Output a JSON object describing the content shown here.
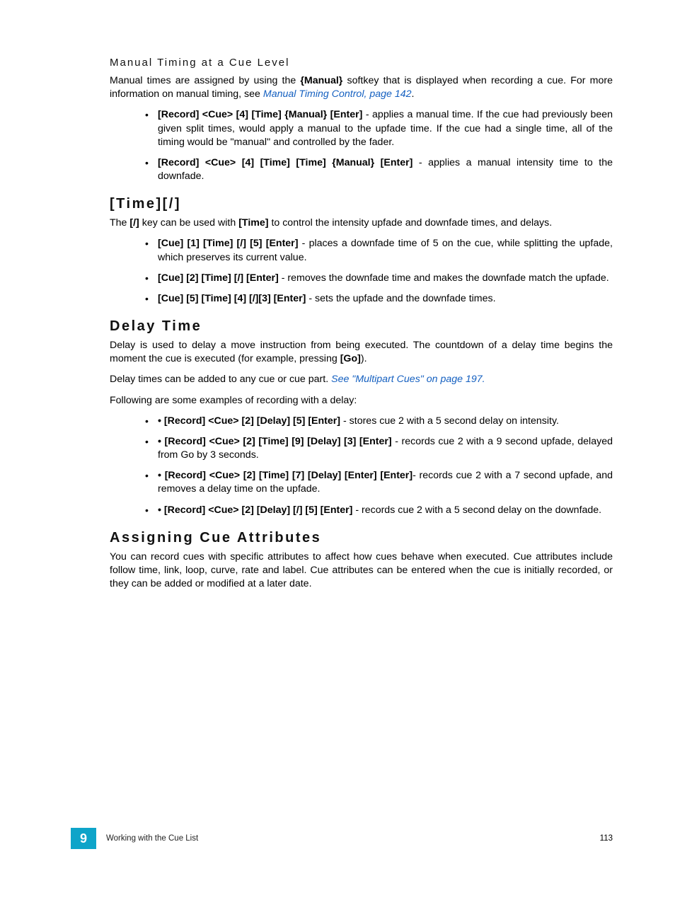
{
  "section_manual_timing": {
    "heading": "Manual Timing at a Cue Level",
    "para1_pre": "Manual times are assigned by using the ",
    "para1_b1": "{Manual}",
    "para1_mid": " softkey that is displayed when recording a cue. For more information on manual timing, see ",
    "para1_link": "Manual Timing Control, page 142",
    "para1_post": ".",
    "bullets": [
      {
        "bold": "[Record] <Cue> [4] [Time] {Manual} [Enter]",
        "rest": " - applies a manual time. If the cue had previously been given split times, would apply a manual to the upfade time. If the cue had a single time, all of the timing would be \"manual\" and controlled by the fader."
      },
      {
        "bold": "[Record] <Cue> [4] [Time] [Time] {Manual} [Enter]",
        "rest": " - applies a manual intensity time to the downfade."
      }
    ]
  },
  "section_time_slash": {
    "heading": "[Time][/]",
    "para_pre": "The ",
    "para_b1": "[/]",
    "para_mid": " key can be used with ",
    "para_b2": "[Time]",
    "para_post": " to control the intensity upfade and downfade times, and delays.",
    "bullets": [
      {
        "bold": "[Cue] [1] [Time] [/] [5] [Enter]",
        "rest": " - places a downfade time of 5 on the cue, while splitting the upfade, which preserves its current value."
      },
      {
        "bold": "[Cue] [2] [Time] [/] [Enter]",
        "rest": " - removes the downfade time and makes the downfade match the upfade."
      },
      {
        "bold": "[Cue] [5] [Time] [4] [/][3] [Enter]",
        "rest": " - sets the upfade and the downfade times."
      }
    ]
  },
  "section_delay": {
    "heading": "Delay Time",
    "para1_pre": "Delay is used to delay a move instruction from being executed. The countdown of a delay time begins the moment the cue is executed (for example, pressing ",
    "para1_b1": "[Go]",
    "para1_post": ").",
    "para2_pre": "Delay times can be added to any cue or cue part. ",
    "para2_link": "See \"Multipart Cues\" on page 197.",
    "para3": "Following are some examples of recording with a delay:",
    "bullets": [
      {
        "pre": "• ",
        "bold": "[Record] <Cue> [2] [Delay] [5] [Enter]",
        "rest": " - stores cue 2 with a 5 second delay on intensity."
      },
      {
        "pre": "• ",
        "bold": "[Record] <Cue> [2] [Time] [9] [Delay] [3] [Enter]",
        "rest": " - records cue 2 with a 9 second upfade, delayed from Go by 3 seconds."
      },
      {
        "pre": "• ",
        "bold": "[Record] <Cue> [2] [Time] [7] [Delay] [Enter] [Enter]",
        "rest": "- records cue 2 with a 7 second upfade, and removes a delay time on the upfade."
      },
      {
        "pre": "• ",
        "bold": "[Record] <Cue> [2] [Delay] [/] [5] [Enter]",
        "rest": " - records cue 2 with a 5 second delay on the downfade."
      }
    ]
  },
  "section_attrs": {
    "heading": "Assigning Cue Attributes",
    "para": "You can record cues with specific attributes to affect how cues behave when executed. Cue attributes include follow time, link, loop, curve, rate and label. Cue attributes can be entered when the cue is initially recorded, or they can be added or modified at a later date."
  },
  "footer": {
    "chapter_number": "9",
    "title": "Working with the Cue List",
    "page": "113"
  }
}
